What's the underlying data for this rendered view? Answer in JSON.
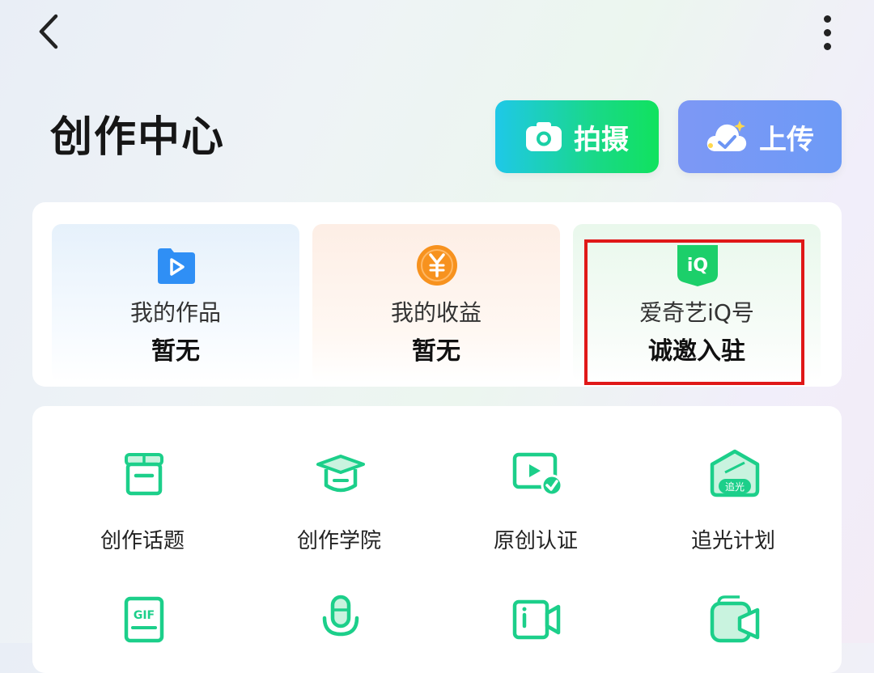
{
  "header": {
    "title": "创作中心",
    "back_icon": "chevron-left-icon",
    "more_icon": "more-vertical-icon"
  },
  "actions": {
    "shoot_label": "拍摄",
    "shoot_icon": "camera-icon",
    "upload_label": "上传",
    "upload_icon": "cloud-upload-icon"
  },
  "stats": [
    {
      "label": "我的作品",
      "value": "暂无",
      "icon": "video-play-icon"
    },
    {
      "label": "我的收益",
      "value": "暂无",
      "icon": "yuan-coin-icon"
    },
    {
      "label": "爱奇艺iQ号",
      "value": "诚邀入驻",
      "icon": "iq-badge-icon",
      "icon_text": "iQ"
    }
  ],
  "menu": [
    {
      "label": "创作话题",
      "icon": "gift-box-icon"
    },
    {
      "label": "创作学院",
      "icon": "graduation-cap-icon"
    },
    {
      "label": "原创认证",
      "icon": "video-verified-icon"
    },
    {
      "label": "追光计划",
      "icon": "house-badge-icon",
      "icon_text": "追光"
    },
    {
      "label": "",
      "icon": "gif-icon",
      "icon_text": "GIF"
    },
    {
      "label": "",
      "icon": "microphone-icon"
    },
    {
      "label": "",
      "icon": "video-camera-icon"
    },
    {
      "label": "",
      "icon": "live-video-icon"
    }
  ],
  "colors": {
    "accent_green": "#1ccf8a",
    "shoot_gradient_start": "#1fc8e8",
    "shoot_gradient_end": "#11e25e",
    "upload_blue": "#7695f5",
    "highlight_red": "#e01818",
    "coin_orange": "#f7921e",
    "video_blue": "#2f8ff5"
  }
}
